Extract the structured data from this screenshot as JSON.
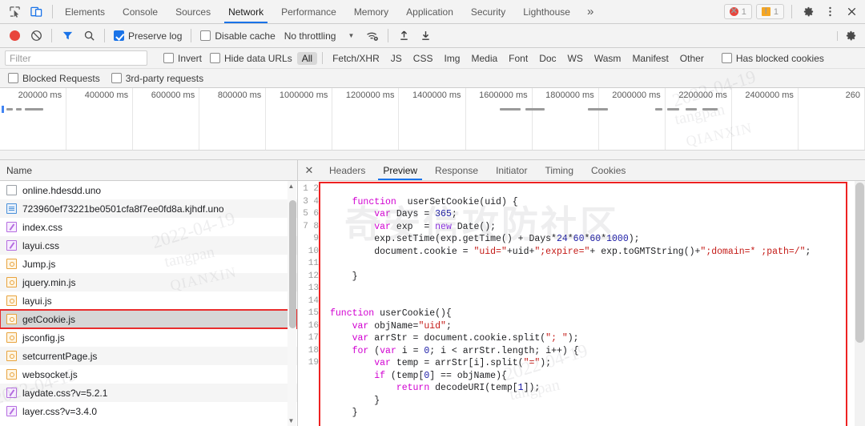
{
  "watermarks": {
    "brand_cn": "奇安信攻防社区",
    "date1": "2022-04-19",
    "date2": "2022-04-19",
    "date3": "2022-04-19",
    "tangpan": "tangpan",
    "qianxin": "QIANXIN"
  },
  "tabbar": {
    "inspect_icon": "inspect-element-icon",
    "device_icon": "device-toolbar-icon",
    "tabs": [
      {
        "label": "Elements",
        "active": false
      },
      {
        "label": "Console",
        "active": false
      },
      {
        "label": "Sources",
        "active": false
      },
      {
        "label": "Network",
        "active": true
      },
      {
        "label": "Performance",
        "active": false
      },
      {
        "label": "Memory",
        "active": false
      },
      {
        "label": "Application",
        "active": false
      },
      {
        "label": "Security",
        "active": false
      },
      {
        "label": "Lighthouse",
        "active": false
      }
    ],
    "more_label": "»",
    "error_count": "1",
    "warning_count": "1",
    "error_glyph": "✕",
    "warning_glyph": "!",
    "settings_icon": "gear-icon",
    "menu_icon": "kebab-menu-icon",
    "close_icon": "close-icon",
    "close_glyph": "✕"
  },
  "controlbar": {
    "record_label": "record-button",
    "clear_label": "clear-button",
    "filter_icon": "filter-funnel-icon",
    "search_icon": "search-icon",
    "preserve_log": {
      "label": "Preserve log",
      "checked": true
    },
    "disable_cache": {
      "label": "Disable cache",
      "checked": false
    },
    "throttling": {
      "value": "No throttling",
      "caret": "▼"
    },
    "wifi_icon": "network-conditions-icon",
    "import_icon": "import-har-icon",
    "export_icon": "export-har-icon",
    "settings_icon": "network-settings-gear-icon"
  },
  "filterbar": {
    "filter_placeholder": "Filter",
    "filter_value": "",
    "invert": {
      "label": "Invert",
      "checked": false
    },
    "hide_data_urls": {
      "label": "Hide data URLs",
      "checked": false
    },
    "types": [
      {
        "label": "All",
        "selected": true
      },
      {
        "label": "Fetch/XHR",
        "selected": false
      },
      {
        "label": "JS",
        "selected": false
      },
      {
        "label": "CSS",
        "selected": false
      },
      {
        "label": "Img",
        "selected": false
      },
      {
        "label": "Media",
        "selected": false
      },
      {
        "label": "Font",
        "selected": false
      },
      {
        "label": "Doc",
        "selected": false
      },
      {
        "label": "WS",
        "selected": false
      },
      {
        "label": "Wasm",
        "selected": false
      },
      {
        "label": "Manifest",
        "selected": false
      },
      {
        "label": "Other",
        "selected": false
      }
    ],
    "has_blocked_cookies": {
      "label": "Has blocked cookies",
      "checked": false
    }
  },
  "blockedbar": {
    "blocked_requests": {
      "label": "Blocked Requests",
      "checked": false
    },
    "third_party": {
      "label": "3rd-party requests",
      "checked": false
    }
  },
  "overview": {
    "ticks": [
      "200000 ms",
      "400000 ms",
      "600000 ms",
      "800000 ms",
      "1000000 ms",
      "1200000 ms",
      "1400000 ms",
      "1600000 ms",
      "1800000 ms",
      "2000000 ms",
      "2200000 ms",
      "2400000 ms",
      "260"
    ]
  },
  "netlist": {
    "column_name": "Name",
    "rows": [
      {
        "name": "online.hdesdd.uno",
        "icon": "doc-icon",
        "type": "doc",
        "selected": false,
        "highlighted": false
      },
      {
        "name": "723960ef73221be0501cfa8f7ee0fd8a.kjhdf.uno",
        "icon": "document-blue-icon",
        "type": "docblue",
        "selected": false,
        "highlighted": false
      },
      {
        "name": "index.css",
        "icon": "css-file-icon",
        "type": "css",
        "selected": false,
        "highlighted": false
      },
      {
        "name": "layui.css",
        "icon": "css-file-icon",
        "type": "css",
        "selected": false,
        "highlighted": false
      },
      {
        "name": "Jump.js",
        "icon": "js-file-icon",
        "type": "js",
        "selected": false,
        "highlighted": false
      },
      {
        "name": "jquery.min.js",
        "icon": "js-file-icon",
        "type": "js",
        "selected": false,
        "highlighted": false
      },
      {
        "name": "layui.js",
        "icon": "js-file-icon",
        "type": "js",
        "selected": false,
        "highlighted": false
      },
      {
        "name": "getCookie.js",
        "icon": "js-file-icon",
        "type": "js",
        "selected": true,
        "highlighted": true
      },
      {
        "name": "jsconfig.js",
        "icon": "js-file-icon",
        "type": "js",
        "selected": false,
        "highlighted": false
      },
      {
        "name": "setcurrentPage.js",
        "icon": "js-file-icon",
        "type": "js",
        "selected": false,
        "highlighted": false
      },
      {
        "name": "websocket.js",
        "icon": "js-file-icon",
        "type": "js",
        "selected": false,
        "highlighted": false
      },
      {
        "name": "laydate.css?v=5.2.1",
        "icon": "css-file-icon",
        "type": "css",
        "selected": false,
        "highlighted": false
      },
      {
        "name": "layer.css?v=3.4.0",
        "icon": "css-file-icon",
        "type": "css",
        "selected": false,
        "highlighted": false
      }
    ],
    "scroll_up_glyph": "▲",
    "scroll_down_glyph": "▼"
  },
  "detail": {
    "close_glyph": "✕",
    "tabs": [
      {
        "label": "Headers",
        "active": false
      },
      {
        "label": "Preview",
        "active": true
      },
      {
        "label": "Response",
        "active": false
      },
      {
        "label": "Initiator",
        "active": false
      },
      {
        "label": "Timing",
        "active": false
      },
      {
        "label": "Cookies",
        "active": false
      }
    ],
    "line_numbers": [
      "1",
      "2",
      "3",
      "4",
      "5",
      "6",
      "7",
      "8",
      "9",
      "10",
      "11",
      "12",
      "13",
      "14",
      "15",
      "16",
      "17",
      "18",
      "19"
    ],
    "code_lines": [
      "",
      "    function  userSetCookie(uid) {",
      "        var Days = 365;",
      "        var exp  = new Date();",
      "        exp.setTime(exp.getTime() + Days*24*60*60*1000);",
      "        document.cookie = \"uid=\"+uid+\";expire=\"+ exp.toGMTString()+\";domain=* ;path=/\";",
      "",
      "    }",
      "",
      "",
      "function userCookie(){",
      "    var objName=\"uid\";",
      "    var arrStr = document.cookie.split(\"; \");",
      "    for (var i = 0; i < arrStr.length; i++) {",
      "        var temp = arrStr[i].split(\"=\");",
      "        if (temp[0] == objName){",
      "            return decodeURI(temp[1]);",
      "        }",
      "    }"
    ]
  }
}
